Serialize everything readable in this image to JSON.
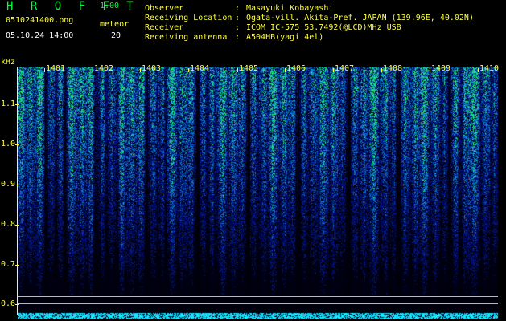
{
  "header": {
    "app_title": "H R O F F T",
    "app_version": "1.00",
    "file_name": "0510241400.png",
    "mode_label": "meteor",
    "date_time": "05.10.24 14:00",
    "count_value": "20"
  },
  "info": {
    "separator": ":",
    "observer_label": "Observer",
    "observer_value": "Masayuki Kobayashi",
    "location_label": "Receiving Location",
    "location_value": "Ogata-vill. Akita-Pref. JAPAN (139.96E, 40.02N)",
    "receiver_label": "Receiver",
    "receiver_value": "ICOM IC-575 53.7492(@LCD)MHz USB",
    "antenna_label": "Receiving antenna",
    "antenna_value": "A504HB(yagi 4el)"
  },
  "axis": {
    "unit": "kHz",
    "y_labels": [
      "1.1",
      "1.0",
      "0.9",
      "0.8",
      "0.7",
      "0.6"
    ],
    "x_labels": [
      "1401",
      "1402",
      "1403",
      "1404",
      "1405",
      "1406",
      "1407",
      "1408",
      "1409",
      "1410"
    ]
  },
  "colors": {
    "title_green": "#00ff40",
    "label_yellow": "#ffff40",
    "spectrogram_low": "#000010",
    "spectrogram_mid": "#1430c8",
    "spectrogram_high": "#28ff60",
    "baseline_cyan": "#20d8ff"
  }
}
